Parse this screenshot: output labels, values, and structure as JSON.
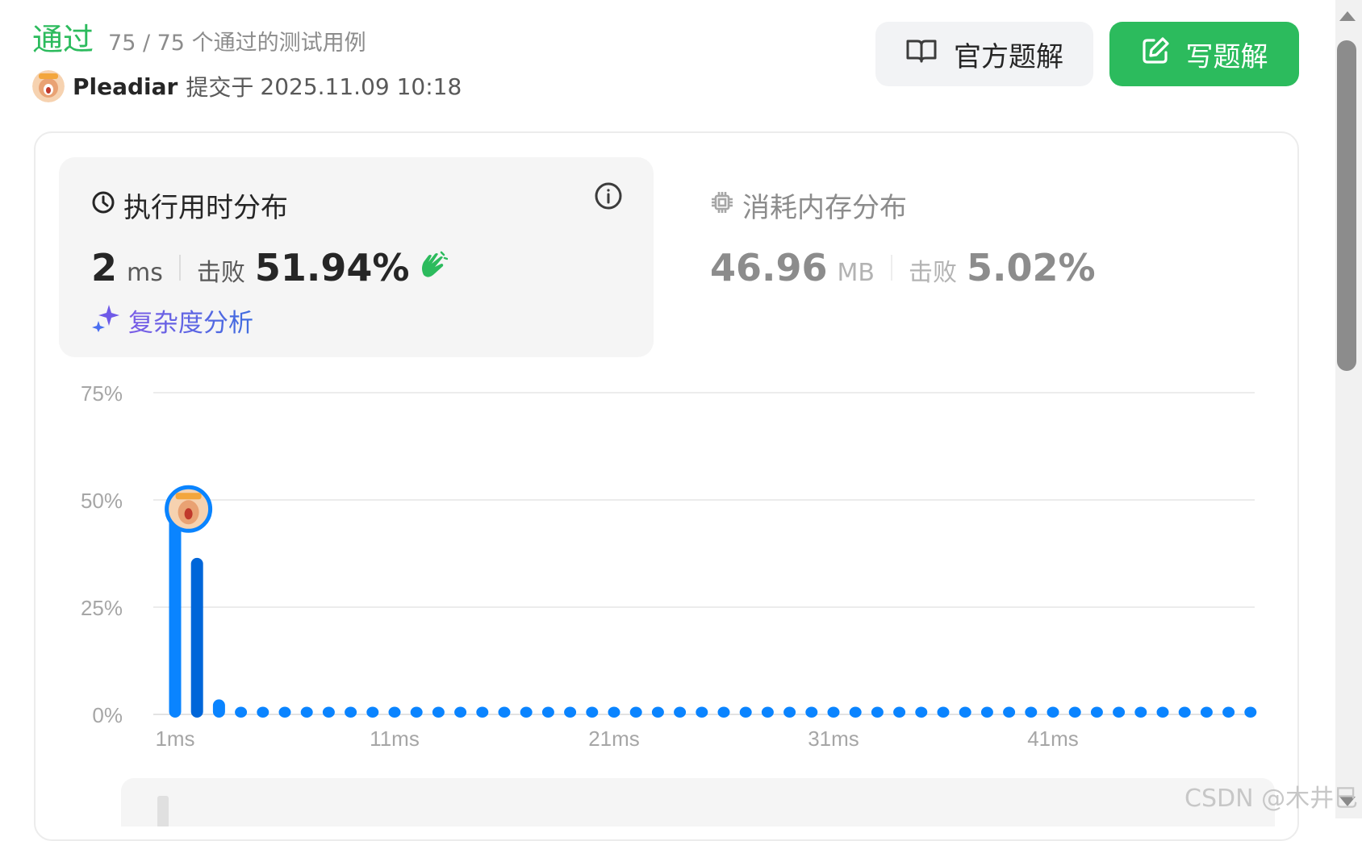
{
  "header": {
    "status": "通过",
    "passed_count": "75 / 75 个通过的测试用例",
    "username": "Pleadiar",
    "submitted_label": "提交于",
    "submitted_time": "2025.11.09 10:18"
  },
  "actions": {
    "official_solution": "官方题解",
    "write_solution": "写题解"
  },
  "runtime": {
    "title": "执行用时分布",
    "value": "2",
    "unit": "ms",
    "beats_label": "击败",
    "beats": "51.94%",
    "complexity_link": "复杂度分析"
  },
  "memory": {
    "title": "消耗内存分布",
    "value": "46.96",
    "unit": "MB",
    "beats_label": "击败",
    "beats": "5.02%"
  },
  "colors": {
    "accent_green": "#2cbb5d",
    "bar_blue": "#0a84ff",
    "bar_selected": "#0066d9"
  },
  "chart_data": {
    "type": "bar",
    "x": [
      1,
      2,
      3,
      4,
      5,
      6,
      7,
      8,
      9,
      10,
      11,
      12,
      13,
      14,
      15,
      16,
      17,
      18,
      19,
      20,
      21,
      22,
      23,
      24,
      25,
      26,
      27,
      28,
      29,
      30,
      31,
      32,
      33,
      34,
      35,
      36,
      37,
      38,
      39,
      40,
      41,
      42,
      43,
      44,
      45,
      46,
      47,
      48,
      49,
      50
    ],
    "values": [
      47.5,
      36.5,
      3.5,
      1.5,
      1.5,
      1.5,
      1.5,
      1.5,
      1.5,
      1.5,
      1.5,
      1.5,
      1.5,
      1.5,
      1.5,
      1.5,
      1.5,
      1.5,
      1.5,
      1.5,
      1.5,
      1.5,
      1.5,
      1.5,
      1.5,
      1.5,
      1.5,
      1.5,
      1.5,
      1.5,
      1.5,
      1.5,
      1.5,
      1.5,
      1.5,
      1.5,
      1.5,
      1.5,
      1.5,
      1.5,
      1.5,
      1.5,
      1.5,
      1.5,
      1.5,
      1.5,
      1.5,
      1.5,
      1.5,
      1.5
    ],
    "x_tick_labels": [
      "1ms",
      "11ms",
      "21ms",
      "31ms",
      "41ms"
    ],
    "x_tick_values": [
      1,
      11,
      21,
      31,
      41
    ],
    "y_tick_labels": [
      "75%",
      "50%",
      "25%",
      "0%"
    ],
    "y_tick_values": [
      75,
      50,
      25,
      0
    ],
    "ylim": [
      0,
      75
    ],
    "grid": true,
    "highlight_x": 2
  },
  "watermark": "CSDN @木井巳"
}
